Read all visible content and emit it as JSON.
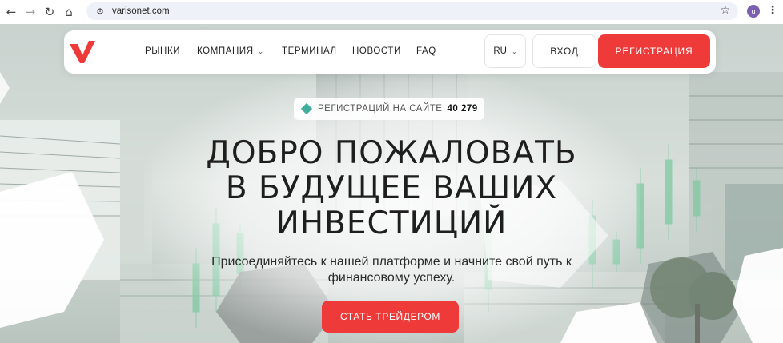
{
  "browser": {
    "url": "varisonet.com",
    "profile_initial": "u",
    "icons": [
      "back-arrow-icon",
      "forward-arrow-icon",
      "reload-icon",
      "home-icon",
      "site-info-icon",
      "star-icon",
      "kebab-menu-icon"
    ]
  },
  "header": {
    "nav": [
      {
        "label": "РЫНКИ"
      },
      {
        "label": "КОМПАНИЯ"
      },
      {
        "label": "ТЕРМИНАЛ"
      },
      {
        "label": "НОВОСТИ"
      },
      {
        "label": "FAQ"
      }
    ],
    "lang": "RU",
    "login_label": "ВХОД",
    "register_label": "РЕГИСТРАЦИЯ"
  },
  "badge": {
    "label": "РЕГИСТРАЦИЙ НА САЙТЕ",
    "count": "40 279"
  },
  "hero": {
    "title_lines": [
      "ДОБРО ПОЖАЛОВАТЬ",
      "В БУДУЩЕЕ ВАШИХ",
      "ИНВЕСТИЦИЙ"
    ],
    "subtitle": "Присоединяйтесь к нашей платформе и начните свой путь к финансовому успеху.",
    "cta_label": "СТАТЬ ТРЕЙДЕРОМ"
  },
  "colors": {
    "accent": "#ef3a3a",
    "badge_icon": "#3fae9a",
    "candle_green": "#7ec9a1"
  }
}
